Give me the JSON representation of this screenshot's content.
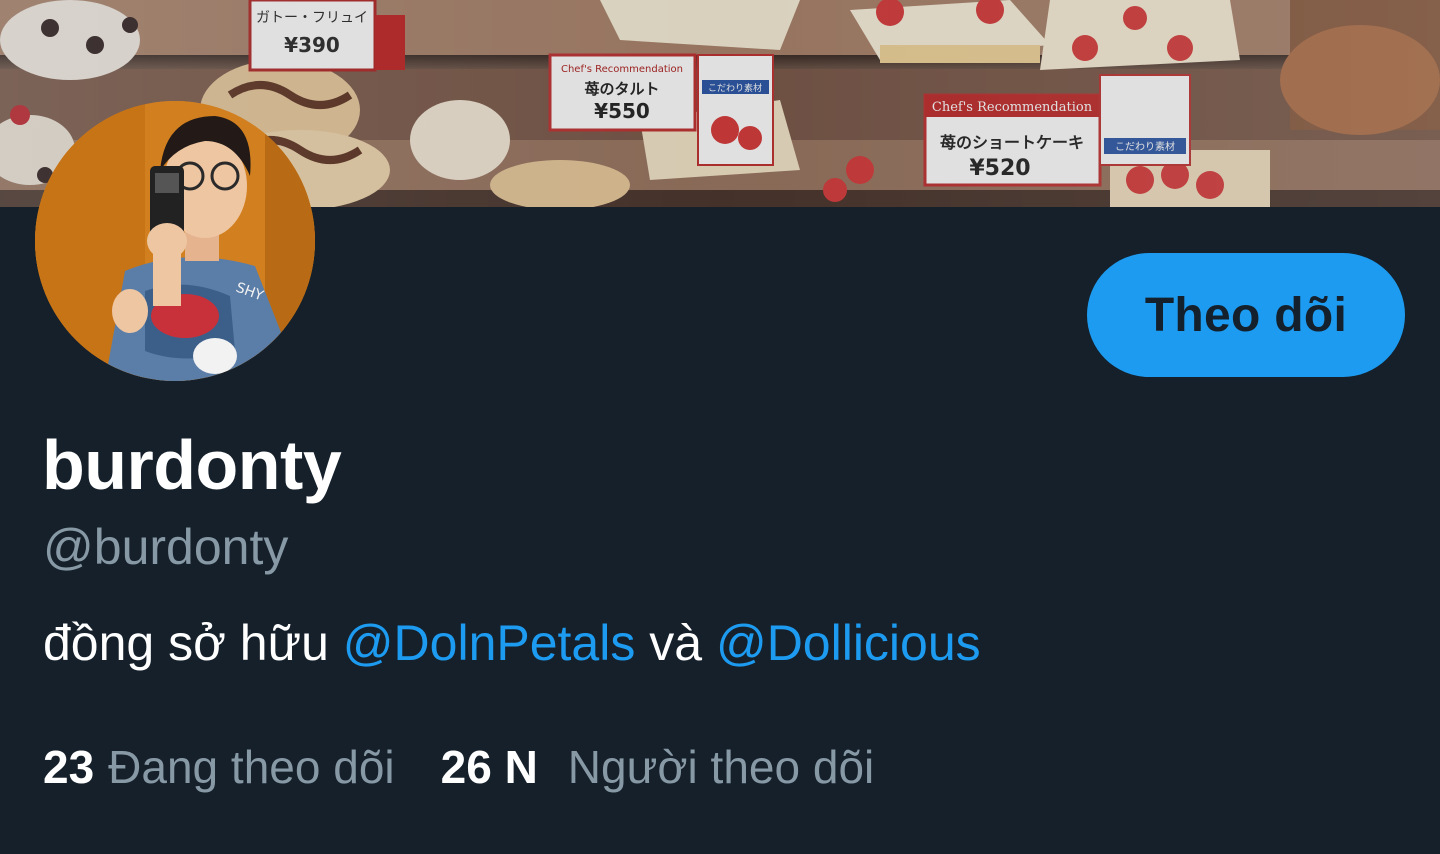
{
  "profile": {
    "display_name": "burdonty",
    "handle": "@burdonty",
    "bio": {
      "prefix": "đồng sở hữu ",
      "mention_1": "@DolnPetals",
      "connector": " và ",
      "mention_2": "@Dollicious"
    },
    "follow_button_label": "Theo dõi"
  },
  "stats": {
    "following_count": "23",
    "following_label": "Đang theo dõi",
    "followers_count": "26 N",
    "followers_label": "Người theo dõi"
  },
  "banner": {
    "description_icon": "pastry-display-photo",
    "price_tags": [
      "¥390",
      "¥550",
      "¥520"
    ],
    "tag_titles": [
      "ガトー・フリュイ",
      "苺のタルト",
      "苺のショートケーキ"
    ],
    "tag_subtitles": [
      "Chef's Recommendation",
      "Chef's Recommendation"
    ],
    "tag_badges": [
      "こだわり素材",
      "こだわり素材"
    ]
  },
  "colors": {
    "background": "#15202b",
    "accent": "#1d9bf0",
    "muted_text": "#8899a6",
    "primary_text": "#ffffff"
  }
}
